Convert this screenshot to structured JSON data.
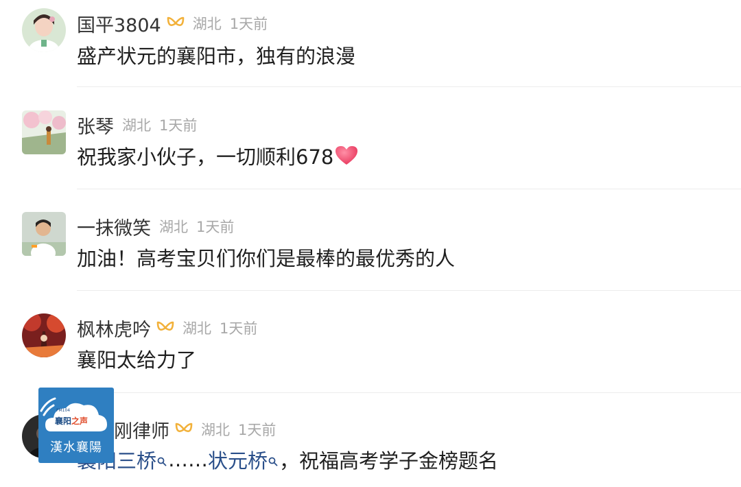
{
  "colors": {
    "username": "#333333",
    "meta": "#a8a8a8",
    "text": "#1f1f1f",
    "topic_link": "#2a4f8a",
    "vip_badge": "#f2b13a",
    "heart": "#ef4d6f",
    "divider": "#ececec",
    "watermark_bg": "#2f7fc1"
  },
  "comments": [
    {
      "username": "国平3804",
      "vip": true,
      "location": "湖北",
      "time": "1天前",
      "text": "盛产状元的襄阳市，独有的浪漫"
    },
    {
      "username": "张琴",
      "vip": false,
      "location": "湖北",
      "time": "1天前",
      "text": "祝我家小伙子，一切顺利678",
      "emoji": "heart-emoji"
    },
    {
      "username": "一抹微笑",
      "vip": false,
      "location": "湖北",
      "time": "1天前",
      "text": "加油！高考宝贝们你们是最棒的最优秀的人"
    },
    {
      "username": "枫林虎吟",
      "vip": true,
      "location": "湖北",
      "time": "1天前",
      "text": "襄阳太给力了"
    },
    {
      "username": "杨显刚律师",
      "vip": true,
      "location": "湖北",
      "time": "1天前",
      "text_parts": {
        "topic1": "襄阳三桥",
        "ellipsis": "……",
        "topic2": "状元桥",
        "rest": "，祝福高考学子金榜题名"
      }
    }
  ],
  "watermark": {
    "fm": "FM104",
    "brand_a": "襄阳",
    "brand_b": "之声",
    "bottom": "漢水襄陽"
  }
}
